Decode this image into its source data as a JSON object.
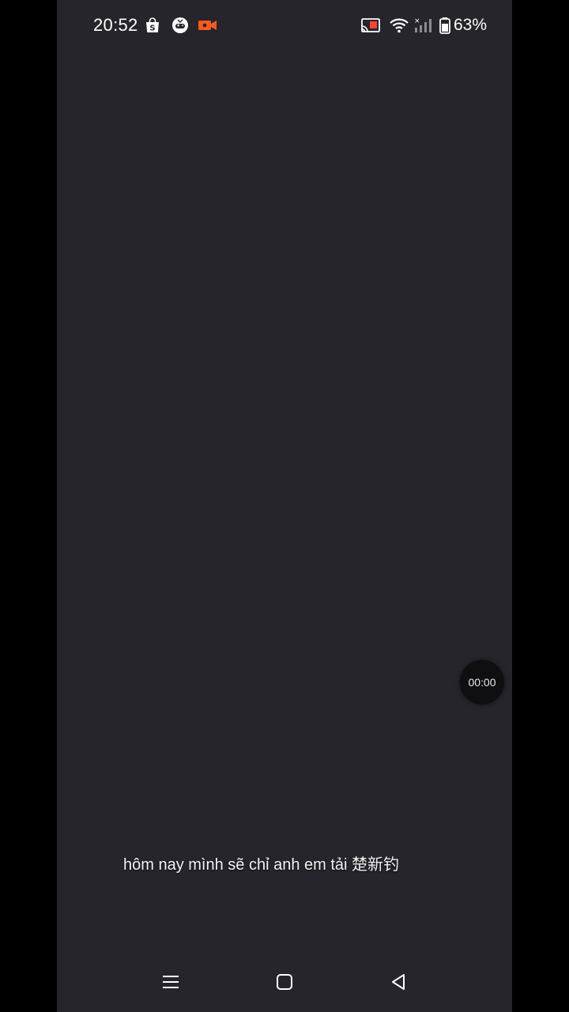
{
  "status_bar": {
    "time": "20:52",
    "battery_percent": "63%",
    "notification_icons": [
      "shopee-bag-icon",
      "game-controller-icon",
      "screen-record-icon"
    ],
    "system_icons": [
      "cast-icon",
      "wifi-icon",
      "signal-icon",
      "battery-icon"
    ],
    "colors": {
      "record_orange": "#ff5a1f",
      "cast_red": "#ff4433",
      "text": "#ffffff"
    }
  },
  "overlay": {
    "timer": "00:00"
  },
  "caption": {
    "text": "hôm nay mình sẽ chỉ anh em tải 楚新钓"
  },
  "nav_bar": {
    "buttons": [
      "recents-icon",
      "home-icon",
      "back-icon"
    ]
  },
  "colors": {
    "screen_bg": "#25252b",
    "letterbox": "#000000"
  }
}
